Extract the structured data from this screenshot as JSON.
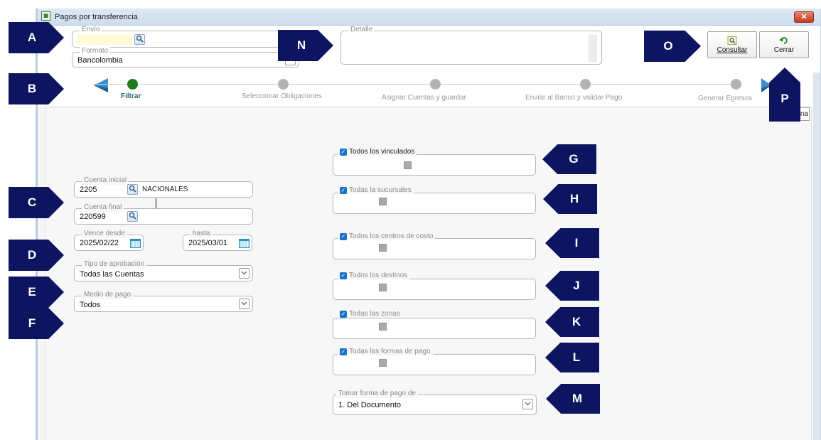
{
  "window": {
    "title": "Pagos por transferencia",
    "close_glyph": "✕"
  },
  "top": {
    "envio_legend": "Envío",
    "envio_value": "",
    "formato_legend": "Formato",
    "formato_value": "Bancolombia",
    "detalle_legend": "Detalle",
    "detalle_value": ""
  },
  "buttons": {
    "consultar": "Consultar",
    "cerrar": "Cerrar"
  },
  "steps": [
    {
      "label": "Filtrar",
      "active": true
    },
    {
      "label": "Seleccionar Obligaciones",
      "active": false
    },
    {
      "label": "Asignar Cuentas y guardar",
      "active": false
    },
    {
      "label": "Enviar al Banco y validar Pago",
      "active": false
    },
    {
      "label": "Generar Egresos",
      "active": false
    }
  ],
  "partial_button_text": "na",
  "filters": {
    "cuenta_inicial_legend": "Cuenta inicial",
    "cuenta_inicial_value": "2205",
    "cuenta_inicial_name": "NACIONALES",
    "cuenta_final_legend": "Cuenta final",
    "cuenta_final_value": "220599",
    "vence_desde_legend": "Vence desde",
    "vence_desde_value": "2025/02/22",
    "hasta_legend": "hasta",
    "hasta_value": "2025/03/01",
    "tipo_aprobacion_legend": "Tipo de aprobación",
    "tipo_aprobacion_value": "Todas las Cuentas",
    "medio_pago_legend": "Medio de pago",
    "medio_pago_value": "Todos"
  },
  "checks": {
    "vinculados": "Todos los vinculados",
    "sucursales": "Todas la sucursales",
    "centros": "Todos los centros de costo",
    "destinos": "Todos los destinos",
    "zonas": "Todas las zonas",
    "formas": "Todas las formas de pago"
  },
  "tomar": {
    "legend": "Tomar forma de pago de",
    "value": "1. Del Documento"
  },
  "callouts": {
    "A": "A",
    "B": "B",
    "C": "C",
    "D": "D",
    "E": "E",
    "F": "F",
    "G": "G",
    "H": "H",
    "I": "I",
    "J": "J",
    "K": "K",
    "L": "L",
    "M": "M",
    "N": "N",
    "O": "O",
    "P": "P"
  },
  "icons": {
    "lookup": "search-icon",
    "calendar": "calendar-icon",
    "dropdown": "chevron-down-icon",
    "check": "checkmark-icon",
    "undo": "undo-arrow-icon"
  },
  "colors": {
    "callout": "#0d1560",
    "active_step": "#1e7a1e",
    "checkbox": "#1a73c8",
    "nav_arrow": "#3a8fd0"
  }
}
